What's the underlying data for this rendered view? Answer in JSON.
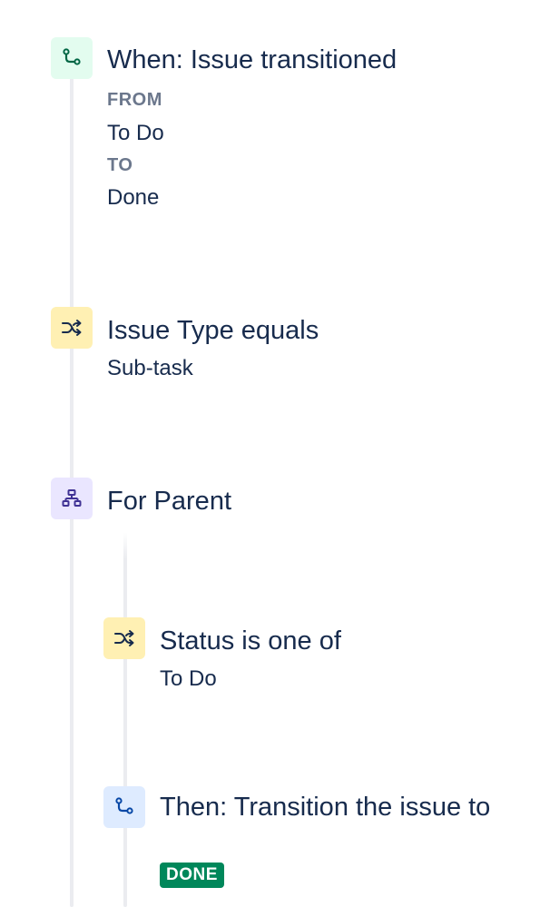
{
  "trigger": {
    "icon": "transition-icon",
    "title": "When: Issue transitioned",
    "from_label": "FROM",
    "from_value": "To Do",
    "to_label": "TO",
    "to_value": "Done"
  },
  "condition_issue_type": {
    "icon": "shuffle-icon",
    "title": "Issue Type equals",
    "value": "Sub-task"
  },
  "branch": {
    "icon": "hierarchy-icon",
    "title": "For Parent"
  },
  "condition_status": {
    "icon": "shuffle-icon",
    "title": "Status is one of",
    "value": "To Do"
  },
  "action": {
    "icon": "transition-icon",
    "title": "Then: Transition the issue to",
    "status_lozenge": "DONE"
  },
  "colors": {
    "trigger_bg": "#e3fcef",
    "trigger_fg": "#006644",
    "condition_bg": "#fff0b3",
    "condition_fg": "#172b4d",
    "branch_bg": "#eae6ff",
    "branch_fg": "#403294",
    "action_bg": "#deebff",
    "action_fg": "#0747a6",
    "done_lozenge": "#00875a"
  }
}
